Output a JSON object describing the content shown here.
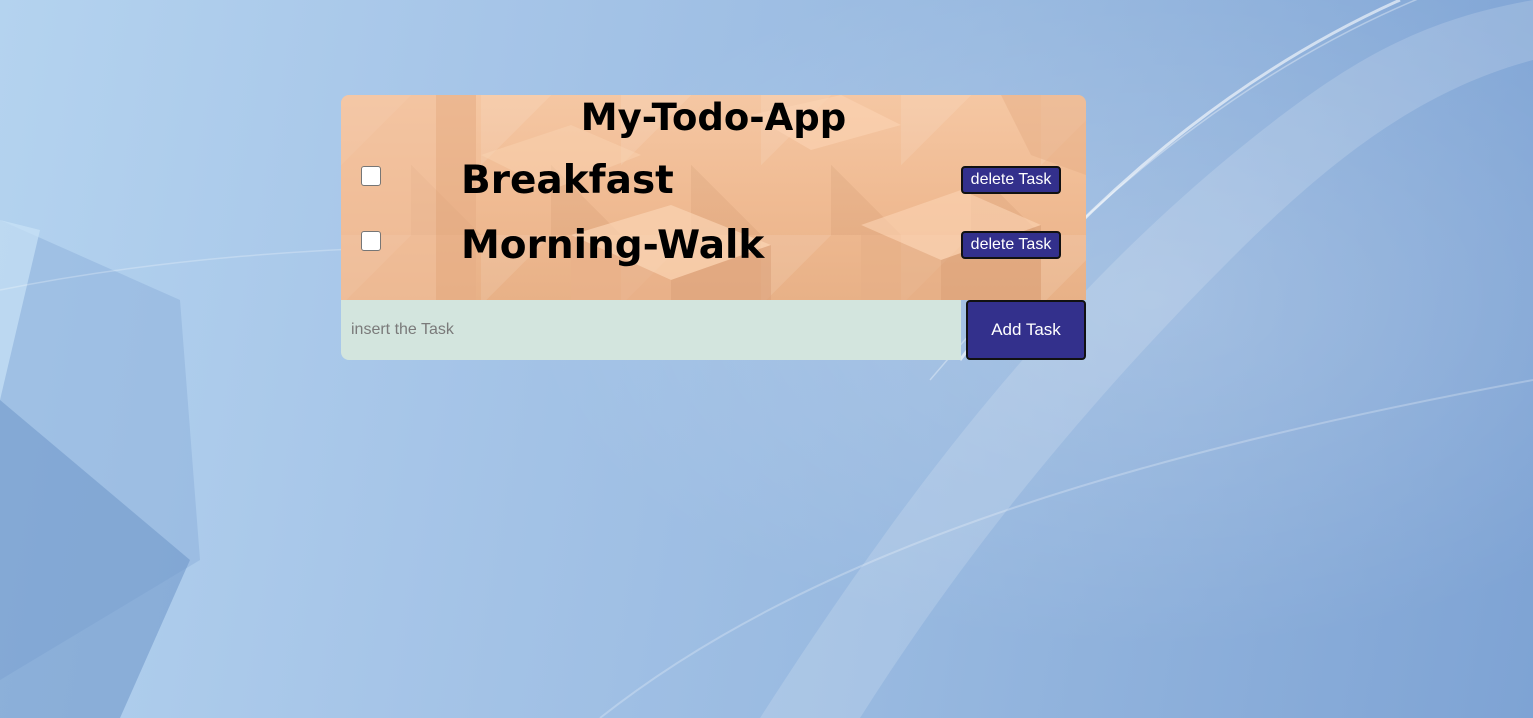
{
  "app": {
    "title": "My-Todo-App"
  },
  "tasks": [
    {
      "text": "Breakfast",
      "checked": false,
      "delete_label": "delete Task"
    },
    {
      "text": "Morning-Walk",
      "checked": false,
      "delete_label": "delete Task"
    }
  ],
  "new_task": {
    "value": "",
    "placeholder": "insert the Task",
    "add_label": "Add Task"
  },
  "colors": {
    "button": "#33308c",
    "input_bg": "#d3e5de",
    "panel_bg": "#f0bb93",
    "page_bg": "#a6c5e8"
  }
}
